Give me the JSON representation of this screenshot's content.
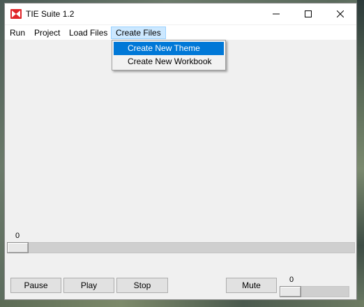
{
  "window": {
    "title": "TIE Suite 1.2"
  },
  "menu": {
    "items": [
      "Run",
      "Project",
      "Load Files",
      "Create Files"
    ],
    "active": "Create Files",
    "dropdown": [
      "Create New Theme",
      "Create New Workbook"
    ],
    "highlighted": "Create New Theme"
  },
  "position_slider": {
    "value_label": "0",
    "value": 0
  },
  "controls": {
    "pause": "Pause",
    "play": "Play",
    "stop": "Stop",
    "mute": "Mute"
  },
  "volume_slider": {
    "value_label": "0",
    "value": 0
  },
  "colors": {
    "menu_highlight": "#0078d7",
    "menu_active_bg": "#cce8ff",
    "window_bg": "#f0f0f0",
    "app_icon_red": "#e0262a"
  },
  "icons": {
    "app": "tie-suite-logo-icon",
    "minimize": "minimize-icon",
    "maximize": "maximize-icon",
    "close": "close-icon"
  }
}
